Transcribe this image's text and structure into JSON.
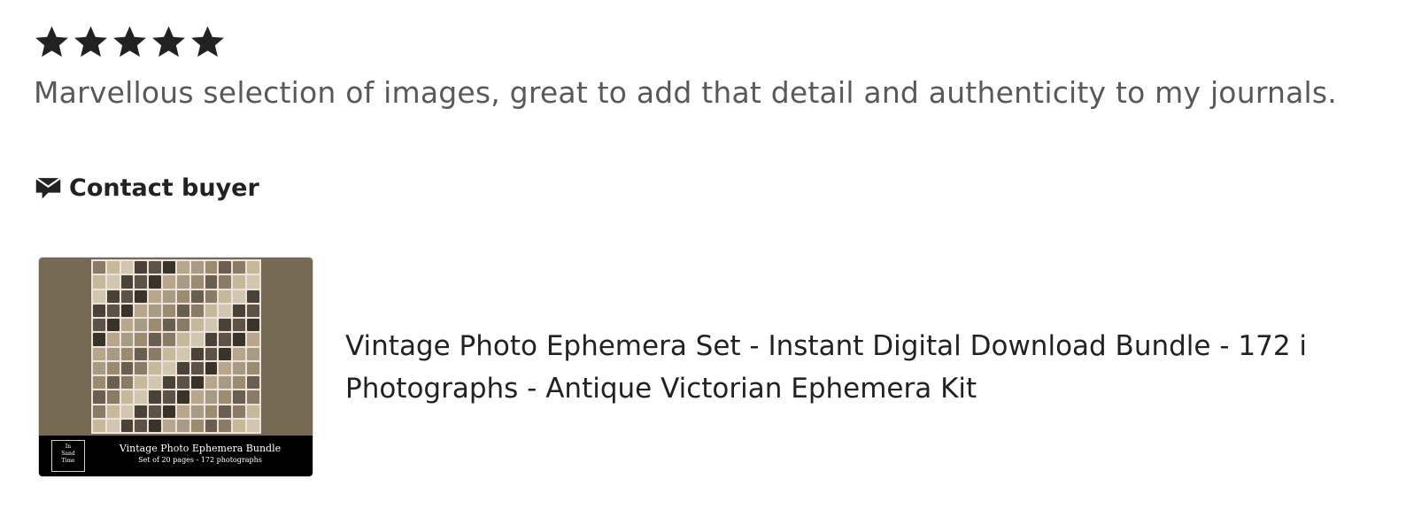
{
  "review": {
    "rating": 5,
    "max_rating": 5,
    "text": "Marvellous selection of images, great to add that detail and authenticity to my journals."
  },
  "contact": {
    "label": "Contact buyer",
    "icon": "message-icon"
  },
  "listing": {
    "thumbnail": {
      "logo_text": [
        "In",
        "Sand",
        "Time"
      ],
      "title": "Vintage Photo Ephemera Bundle",
      "subtitle": "Set of 20 pages - 172 photographs"
    },
    "title_line1": "Vintage Photo Ephemera Set - Instant Digital Download Bundle - 172 i",
    "title_line2": "Photographs - Antique Victorian Ephemera Kit"
  },
  "colors": {
    "star": "#222222",
    "review_text": "#595959",
    "thumbnail_bg": "#766a55",
    "banner": "#000000"
  }
}
